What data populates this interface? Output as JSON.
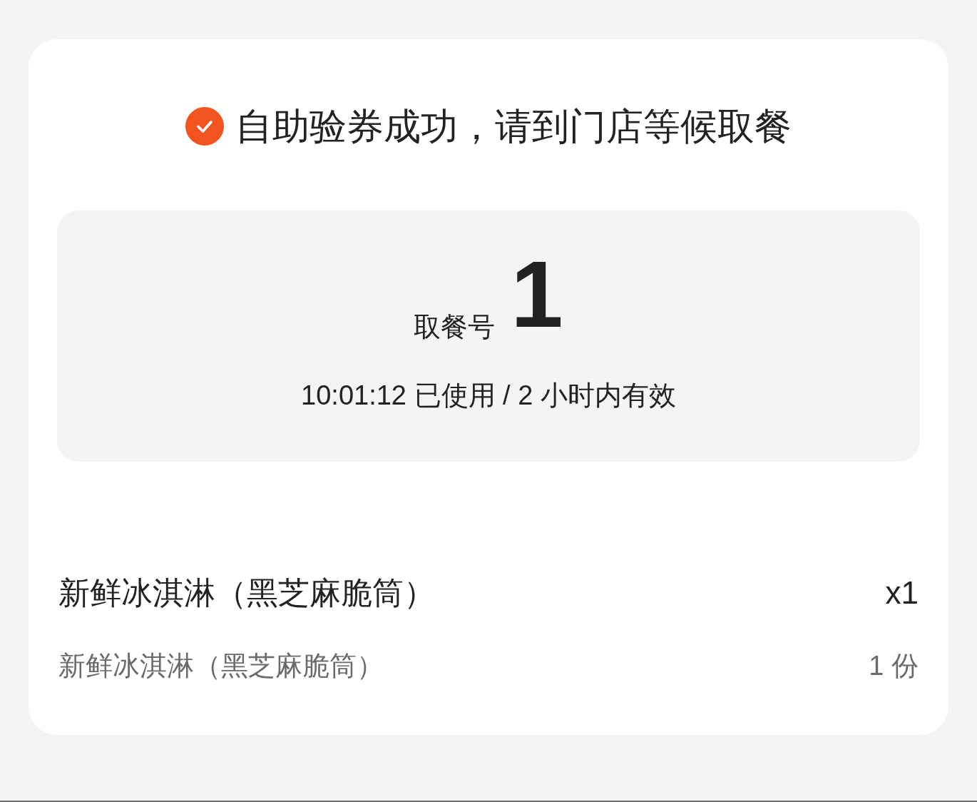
{
  "header": {
    "title": "自助验券成功，请到门店等候取餐"
  },
  "pickup": {
    "label": "取餐号",
    "number": "1",
    "usage": "10:01:12 已使用 / 2 小时内有效"
  },
  "items": [
    {
      "kind": "product",
      "name": "新鲜冰淇淋（黑芝麻脆筒）",
      "quantity": "x1"
    },
    {
      "kind": "component",
      "name": "新鲜冰淇淋（黑芝麻脆筒）",
      "quantity": "1 份"
    }
  ]
}
